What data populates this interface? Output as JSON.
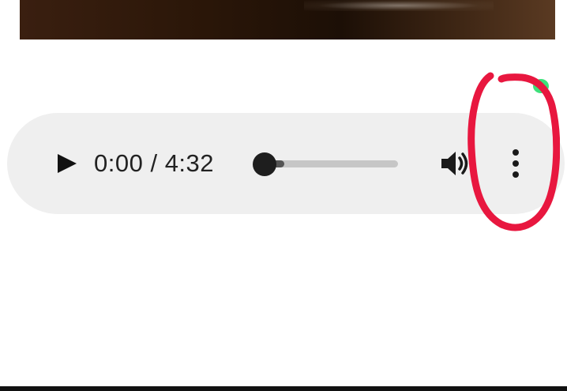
{
  "video_thumbnail": {
    "icon": "video-frame"
  },
  "audio_player": {
    "play_icon": "play-icon",
    "current_time": "0:00",
    "separator": " / ",
    "duration": "4:32",
    "progress": 0.0,
    "buffered": 0.08,
    "volume_icon": "volume-icon",
    "menu_icon": "more-vert-icon"
  },
  "annotation": {
    "shape": "hand-drawn-circle",
    "color": "#e8173f"
  },
  "colors": {
    "player_background": "#efefef",
    "text": "#222222",
    "track": "#c6c6c6",
    "buffered": "#555555",
    "thumb": "#1e1e1e",
    "notification_dot": "#3de07a"
  }
}
